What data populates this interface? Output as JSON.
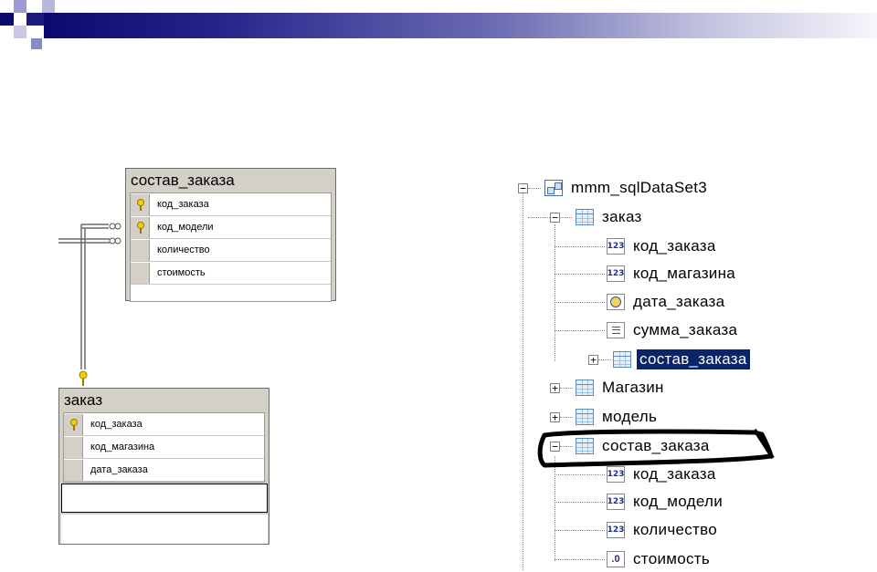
{
  "banner": {
    "accent": "#0a0a6e"
  },
  "diagram": {
    "table1": {
      "title": "состав_заказа",
      "columns": [
        {
          "name": "код_заказа",
          "key": true
        },
        {
          "name": "код_модели",
          "key": true
        },
        {
          "name": "количество",
          "key": false
        },
        {
          "name": "стоимость",
          "key": false
        }
      ]
    },
    "table2": {
      "title": "заказ",
      "columns": [
        {
          "name": "код_заказа",
          "key": true
        },
        {
          "name": "код_магазина",
          "key": false
        },
        {
          "name": "дата_заказа",
          "key": false
        }
      ]
    }
  },
  "tree": {
    "root": "mmm_sqlDataSet3",
    "zakaz": "заказ",
    "zakaz_cols": [
      "код_заказа",
      "код_магазина",
      "дата_заказа",
      "сумма_заказа"
    ],
    "zakaz_child": "состав_заказа",
    "magazin": "Магазин",
    "model": "модель",
    "sostav": "состав_заказа",
    "sostav_cols": [
      "код_заказа",
      "код_модели",
      "количество",
      "стоимость"
    ],
    "icons": {
      "root": "dataset-icon",
      "table": "table-icon",
      "int": "integer-column-icon",
      "datetime": "datetime-column-icon",
      "text": "text-column-icon",
      "decimal": "decimal-column-icon"
    },
    "icon_text": {
      "int": "123",
      "decimal": ".0"
    }
  }
}
